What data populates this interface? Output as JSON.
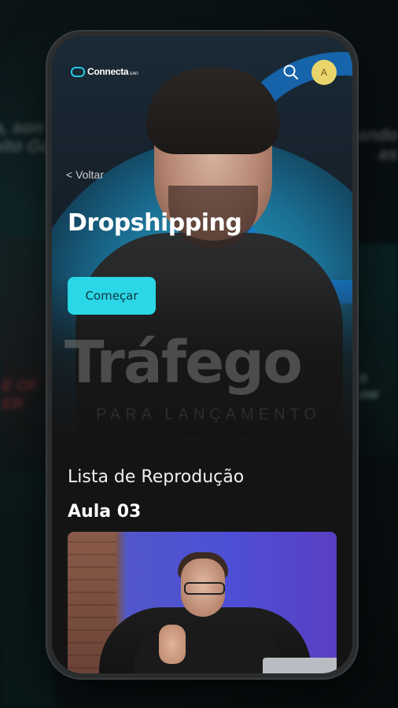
{
  "app": {
    "brand": "Connecta",
    "brand_suffix": "EAD",
    "avatar_initial": "A"
  },
  "background": {
    "left_text": "a, son\nuito Go",
    "right_text": "ando\nas",
    "left_overlay": "E OF\nER",
    "right_overlay": "o\now"
  },
  "hero": {
    "back_label": "< Voltar",
    "title": "Dropshipping",
    "start_button": "Começar",
    "watermark": "Tráfego",
    "watermark_sub": "PARA LANÇAMENTO"
  },
  "playlist": {
    "section_title": "Lista de Reprodução",
    "lesson_title": "Aula 03"
  },
  "colors": {
    "accent": "#2ad7e6",
    "avatar_bg": "#e9d56b",
    "background": "#141414"
  },
  "icons": {
    "search": "search-icon",
    "logo": "connecta-logo"
  }
}
